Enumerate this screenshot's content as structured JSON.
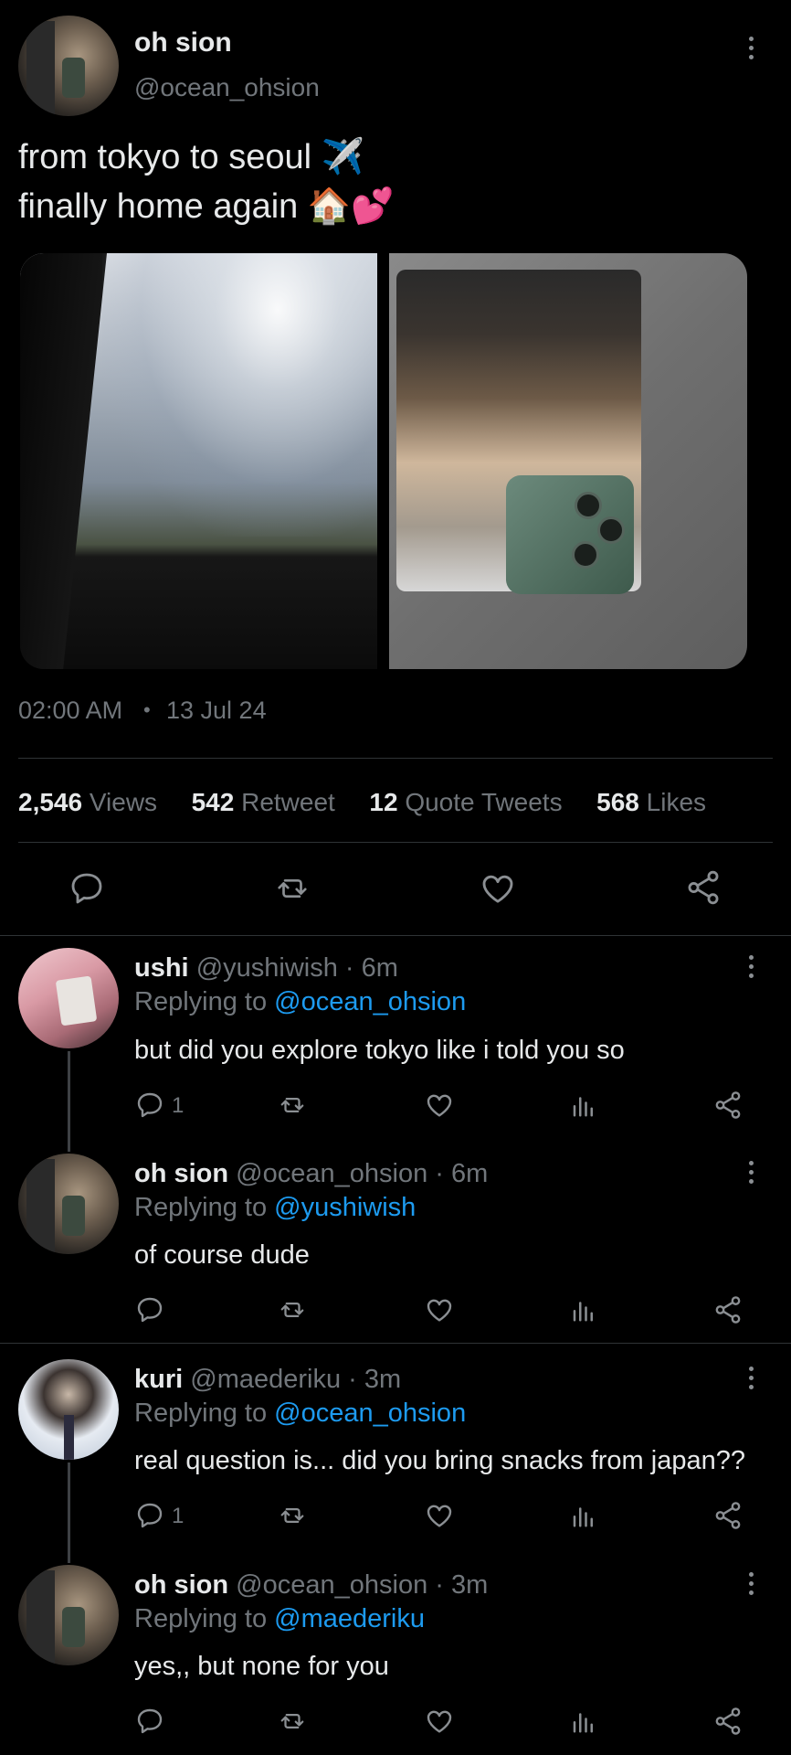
{
  "main_tweet": {
    "name": "oh sion",
    "handle": "@ocean_ohsion",
    "text_line1": "from tokyo to seoul ✈️",
    "text_line2": "finally home again 🏠💕",
    "time": "02:00 AM",
    "dot": "•",
    "date": "13 Jul 24",
    "stats": {
      "views_count": "2,546",
      "views_label": "Views",
      "retweets_count": "542",
      "retweets_label": "Retweet",
      "quotes_count": "12",
      "quotes_label": "Quote Tweets",
      "likes_count": "568",
      "likes_label": "Likes"
    }
  },
  "replies": [
    {
      "name": "ushi",
      "meta": "@yushiwish · 6m",
      "replying_label": "Replying to",
      "replying_to": "@ocean_ohsion",
      "text": "but did you explore tokyo like i told you so",
      "reply_count": "1"
    },
    {
      "name": "oh sion",
      "meta": "@ocean_ohsion · 6m",
      "replying_label": "Replying to",
      "replying_to": "@yushiwish",
      "text": "of course dude",
      "reply_count": ""
    },
    {
      "name": "kuri",
      "meta": "@maederiku · 3m",
      "replying_label": "Replying to",
      "replying_to": "@ocean_ohsion",
      "text": "real question is... did you bring snacks from japan??",
      "reply_count": "1"
    },
    {
      "name": "oh sion",
      "meta": "@ocean_ohsion · 3m",
      "replying_label": "Replying to",
      "replying_to": "@maederiku",
      "text": "yes,, but none for you",
      "reply_count": ""
    }
  ],
  "colors": {
    "background": "#000000",
    "text": "#e7e9ea",
    "secondary": "#71767b",
    "link": "#1d9bf0",
    "divider": "#2f3336"
  },
  "icons": [
    "more-icon",
    "reply-icon",
    "retweet-icon",
    "like-icon",
    "share-icon",
    "views-icon"
  ]
}
